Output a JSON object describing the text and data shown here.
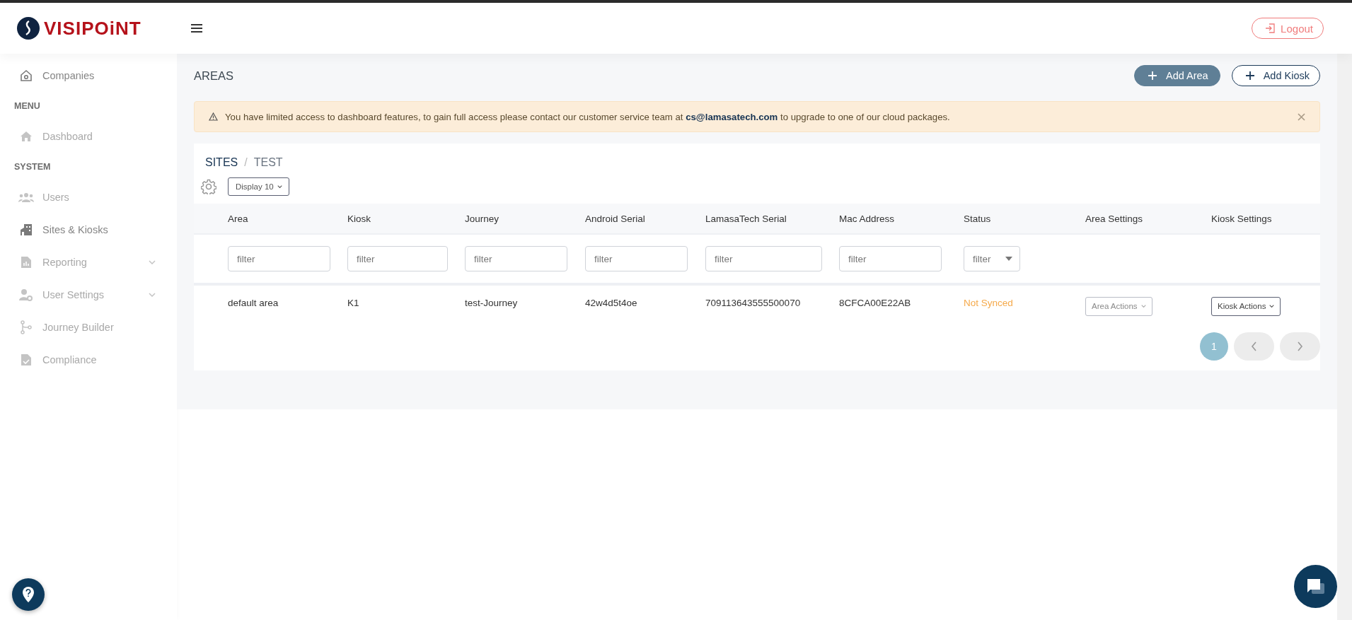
{
  "header": {
    "logo": "VISIPOiNT",
    "logout": "Logout"
  },
  "sidebar": {
    "items": [
      {
        "kind": "link",
        "label": "Companies",
        "disabled": false,
        "expandable": false
      },
      {
        "kind": "section",
        "label": "MENU"
      },
      {
        "kind": "link",
        "label": "Dashboard",
        "disabled": true,
        "expandable": false
      },
      {
        "kind": "section",
        "label": "SYSTEM"
      },
      {
        "kind": "link",
        "label": "Users",
        "disabled": true,
        "expandable": false
      },
      {
        "kind": "link",
        "label": "Sites & Kiosks",
        "disabled": false,
        "expandable": false
      },
      {
        "kind": "link",
        "label": "Reporting",
        "disabled": true,
        "expandable": true
      },
      {
        "kind": "link",
        "label": "User Settings",
        "disabled": true,
        "expandable": true
      },
      {
        "kind": "link",
        "label": "Journey Builder",
        "disabled": true,
        "expandable": false
      },
      {
        "kind": "link",
        "label": "Compliance",
        "disabled": true,
        "expandable": false
      }
    ]
  },
  "page": {
    "title": "AREAS",
    "actions": [
      {
        "label": "Add Area",
        "kind": "primary"
      },
      {
        "label": "Add Kiosk",
        "kind": "outline"
      }
    ]
  },
  "alert": {
    "text": "You have limited access to dashboard features, to gain full access please contact our customer service team at **cs@lamasatech.com** to upgrade to one of our cloud packages."
  },
  "card": {
    "breadcrumb": [
      {
        "label": "SITES",
        "kind": "link"
      },
      {
        "label": "TEST",
        "kind": "current"
      }
    ],
    "separator": "/",
    "display": "Display 10",
    "columns": [
      {
        "label": "Area",
        "filter": {
          "kind": "text",
          "placeholder": "filter"
        }
      },
      {
        "label": "Kiosk",
        "filter": {
          "kind": "text",
          "placeholder": "filter"
        }
      },
      {
        "label": "Journey",
        "filter": {
          "kind": "text",
          "placeholder": "filter"
        }
      },
      {
        "label": "Android Serial",
        "filter": {
          "kind": "text",
          "placeholder": "filter"
        }
      },
      {
        "label": "LamasaTech Serial",
        "filter": {
          "kind": "text",
          "placeholder": "filter"
        }
      },
      {
        "label": "Mac Address",
        "filter": {
          "kind": "text",
          "placeholder": "filter"
        }
      },
      {
        "label": "Status",
        "filter": {
          "kind": "select",
          "placeholder": "filter"
        }
      },
      {
        "label": "Area Settings"
      },
      {
        "label": "Kiosk Settings"
      }
    ],
    "rows": [
      {
        "cells": [
          {
            "kind": "text",
            "text": "default area"
          },
          {
            "kind": "text",
            "text": "K1"
          },
          {
            "kind": "text",
            "text": "test-Journey"
          },
          {
            "kind": "text",
            "text": "42w4d5t4oe"
          },
          {
            "kind": "text",
            "text": "709113643555500070"
          },
          {
            "kind": "text",
            "text": "8CFCA00E22AB"
          },
          {
            "kind": "status",
            "text": "Not Synced"
          },
          {
            "kind": "action",
            "text": "Area Actions",
            "disabled": true
          },
          {
            "kind": "action",
            "text": "Kiosk Actions",
            "disabled": false
          }
        ]
      }
    ],
    "pagination": {
      "pages": [
        {
          "label": "1",
          "selected": true
        }
      ]
    }
  }
}
